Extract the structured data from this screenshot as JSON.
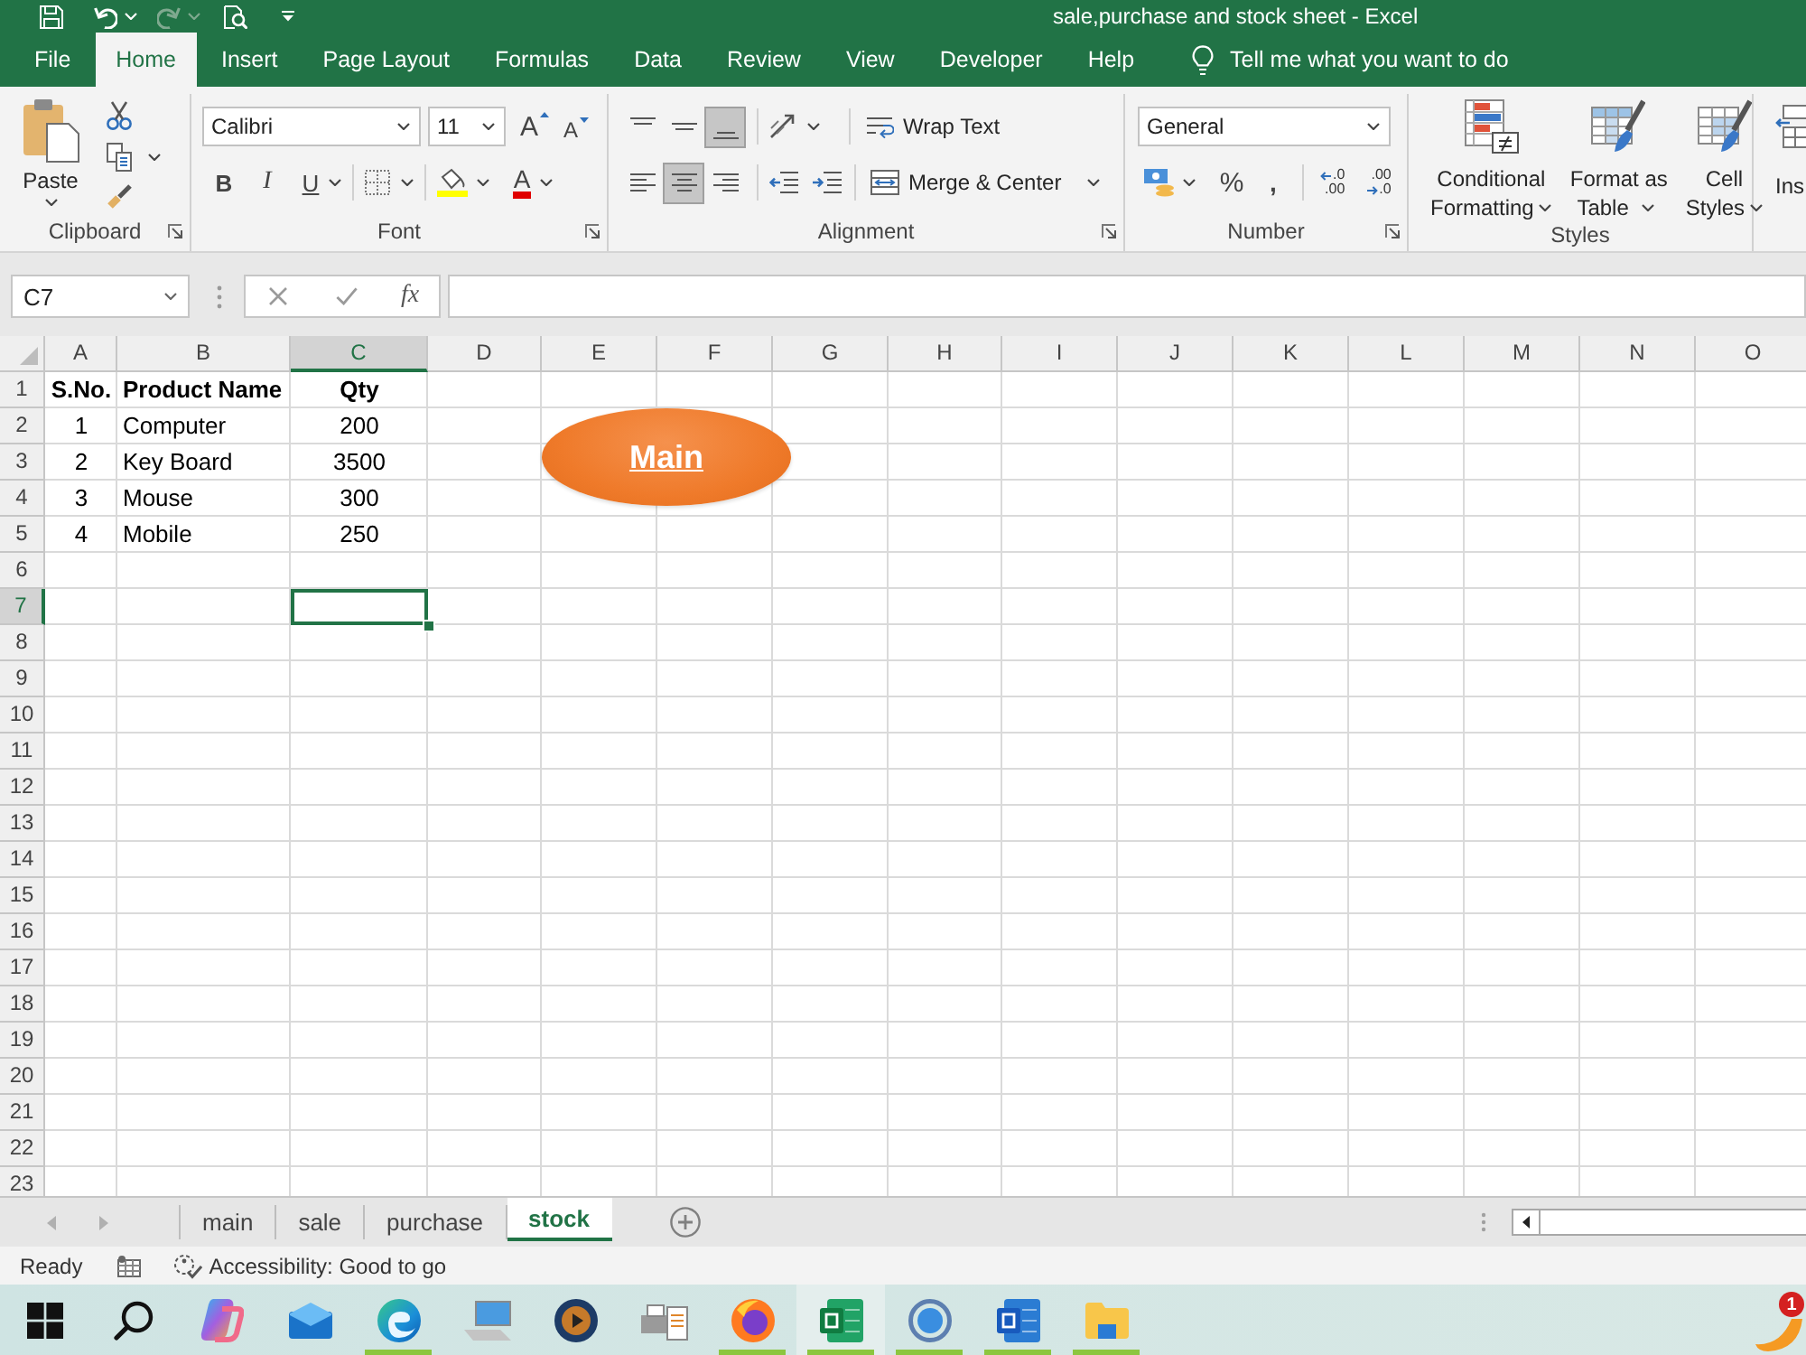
{
  "window": {
    "title": "sale,purchase and stock sheet - Excel"
  },
  "quick_access": [
    {
      "kind": "save",
      "disabled": false
    },
    {
      "kind": "undo",
      "disabled": false
    },
    {
      "kind": "redo",
      "disabled": true
    },
    {
      "kind": "preview",
      "disabled": false
    },
    {
      "kind": "customize",
      "disabled": false
    }
  ],
  "ribbon_tabs": [
    {
      "label": "File",
      "selected": false
    },
    {
      "label": "Home",
      "selected": true
    },
    {
      "label": "Insert",
      "selected": false
    },
    {
      "label": "Page Layout",
      "selected": false
    },
    {
      "label": "Formulas",
      "selected": false
    },
    {
      "label": "Data",
      "selected": false
    },
    {
      "label": "Review",
      "selected": false
    },
    {
      "label": "View",
      "selected": false
    },
    {
      "label": "Developer",
      "selected": false
    },
    {
      "label": "Help",
      "selected": false
    }
  ],
  "tell_me": {
    "label": "Tell me what you want to do"
  },
  "clipboard": {
    "paste": "Paste",
    "group_label": "Clipboard"
  },
  "font": {
    "font_name": "Calibri",
    "font_size": "11",
    "grow": "A",
    "shrink": "A",
    "bold": "B",
    "italic": "I",
    "underline": "U",
    "font_color": "A",
    "group_label": "Font"
  },
  "alignment": {
    "vertical": [
      {
        "kind": "top",
        "selected": false
      },
      {
        "kind": "middle",
        "selected": false
      },
      {
        "kind": "bottom",
        "selected": true
      }
    ],
    "horizontal": [
      {
        "kind": "left",
        "selected": false
      },
      {
        "kind": "center",
        "selected": true
      },
      {
        "kind": "right",
        "selected": false
      }
    ],
    "wrap_text": "Wrap Text",
    "merge": "Merge & Center",
    "group_label": "Alignment"
  },
  "number": {
    "format": "General",
    "percent": "%",
    "comma": ",",
    "decimals": [
      {
        "kind": "increase",
        "top": ".0",
        "bottom": ".00"
      },
      {
        "kind": "decrease",
        "top": ".00",
        "bottom": ".0"
      }
    ],
    "group_label": "Number"
  },
  "styles": {
    "buttons": [
      {
        "kind": "conditional",
        "lines": [
          "Conditional",
          "Formatting"
        ]
      },
      {
        "kind": "table",
        "lines": [
          "Format as",
          "Table"
        ]
      },
      {
        "kind": "cell",
        "lines": [
          "Cell",
          "Styles"
        ]
      }
    ],
    "group_label": "Styles"
  },
  "cells": {
    "insert": "Ins"
  },
  "formula_bar": {
    "name_box": "C7",
    "function_label": "fx"
  },
  "sheet": {
    "columns": [
      {
        "label": "A",
        "selected": false
      },
      {
        "label": "B",
        "selected": false
      },
      {
        "label": "C",
        "selected": true
      },
      {
        "label": "D",
        "selected": false
      },
      {
        "label": "E",
        "selected": false
      },
      {
        "label": "F",
        "selected": false
      },
      {
        "label": "G",
        "selected": false
      },
      {
        "label": "H",
        "selected": false
      },
      {
        "label": "I",
        "selected": false
      },
      {
        "label": "J",
        "selected": false
      },
      {
        "label": "K",
        "selected": false
      },
      {
        "label": "L",
        "selected": false
      },
      {
        "label": "M",
        "selected": false
      },
      {
        "label": "N",
        "selected": false
      },
      {
        "label": "O",
        "selected": false
      }
    ],
    "rows": [
      {
        "label": "1",
        "selected": false,
        "bold": true,
        "cells": [
          "S.No.",
          "Product Name",
          "Qty"
        ]
      },
      {
        "label": "2",
        "selected": false,
        "bold": false,
        "cells": [
          "1",
          "Computer",
          "200"
        ]
      },
      {
        "label": "3",
        "selected": false,
        "bold": false,
        "cells": [
          "2",
          "Key Board",
          "3500"
        ]
      },
      {
        "label": "4",
        "selected": false,
        "bold": false,
        "cells": [
          "3",
          "Mouse",
          "300"
        ]
      },
      {
        "label": "5",
        "selected": false,
        "bold": false,
        "cells": [
          "4",
          "Mobile",
          "250"
        ]
      },
      {
        "label": "6",
        "selected": false
      },
      {
        "label": "7",
        "selected": true
      },
      {
        "label": "8",
        "selected": false
      },
      {
        "label": "9",
        "selected": false
      },
      {
        "label": "10",
        "selected": false
      },
      {
        "label": "11",
        "selected": false
      },
      {
        "label": "12",
        "selected": false
      },
      {
        "label": "13",
        "selected": false
      },
      {
        "label": "14",
        "selected": false
      },
      {
        "label": "15",
        "selected": false
      },
      {
        "label": "16",
        "selected": false
      },
      {
        "label": "17",
        "selected": false
      },
      {
        "label": "18",
        "selected": false
      },
      {
        "label": "19",
        "selected": false
      },
      {
        "label": "20",
        "selected": false
      },
      {
        "label": "21",
        "selected": false
      },
      {
        "label": "22",
        "selected": false
      },
      {
        "label": "23",
        "selected": false
      }
    ],
    "shape": {
      "label": "Main"
    }
  },
  "sheet_tabs": [
    {
      "label": "main",
      "selected": false
    },
    {
      "label": "sale",
      "selected": false
    },
    {
      "label": "purchase",
      "selected": false
    },
    {
      "label": "stock",
      "selected": true
    }
  ],
  "status_bar": {
    "status": "Ready",
    "accessibility": "Accessibility: Good to go"
  },
  "taskbar": {
    "apps": [
      {
        "kind": "start",
        "running": false,
        "selected": false
      },
      {
        "kind": "search",
        "running": false,
        "selected": false
      },
      {
        "kind": "swirl",
        "running": false,
        "selected": false
      },
      {
        "kind": "mail",
        "running": false,
        "selected": false
      },
      {
        "kind": "browser",
        "running": true,
        "selected": false
      },
      {
        "kind": "computer",
        "running": false,
        "selected": false
      },
      {
        "kind": "media",
        "running": false,
        "selected": false
      },
      {
        "kind": "scanner",
        "running": false,
        "selected": false
      },
      {
        "kind": "fox_browser",
        "running": true,
        "selected": false
      },
      {
        "kind": "spreadsheet",
        "running": true,
        "selected": true
      },
      {
        "kind": "globe",
        "running": true,
        "selected": false
      },
      {
        "kind": "document",
        "running": true,
        "selected": false
      },
      {
        "kind": "folder",
        "running": true,
        "selected": false
      }
    ],
    "tray_badge": "1"
  }
}
